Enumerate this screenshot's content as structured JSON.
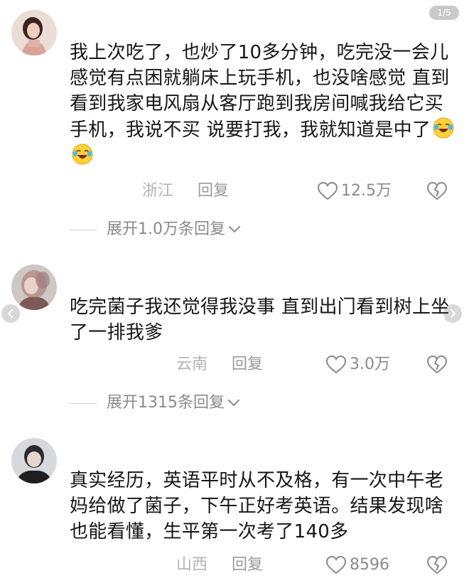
{
  "pager": {
    "label": "1/5"
  },
  "comments": [
    {
      "text": "我上次吃了，也炒了10多分钟，吃完没一会儿感觉有点困就躺床上玩手机，也没啥感觉 直到看到我家电风扇从客厅跑到我房间喊我给它买手机，我说不买 说要打我，我就知道是中了",
      "emojis": [
        "crying-laughing-emoji",
        "crying-laughing-emoji"
      ],
      "location": "浙江",
      "reply_label": "回复",
      "likes": "12.5万",
      "expand_label": "展开1.0万条回复"
    },
    {
      "text": "吃完菌子我还觉得我没事 直到出门看到树上坐了一排我爹",
      "location": "云南",
      "reply_label": "回复",
      "likes": "3.0万",
      "expand_label": "展开1315条回复"
    },
    {
      "text": "真实经历，英语平时从不及格，有一次中午老妈给做了菌子，下午正好考英语。结果发现啥也能看懂，生平第一次考了140多",
      "location": "山西",
      "reply_label": "回复",
      "likes": "8596"
    }
  ],
  "icons": {
    "like": "heart-outline-icon",
    "dislike": "broken-heart-icon",
    "expand": "chevron-down-icon",
    "prev": "chevron-left-icon",
    "next": "chevron-right-icon"
  },
  "colors": {
    "text": "#161616",
    "muted": "#8a8a8a",
    "location": "#b3b3b3"
  }
}
